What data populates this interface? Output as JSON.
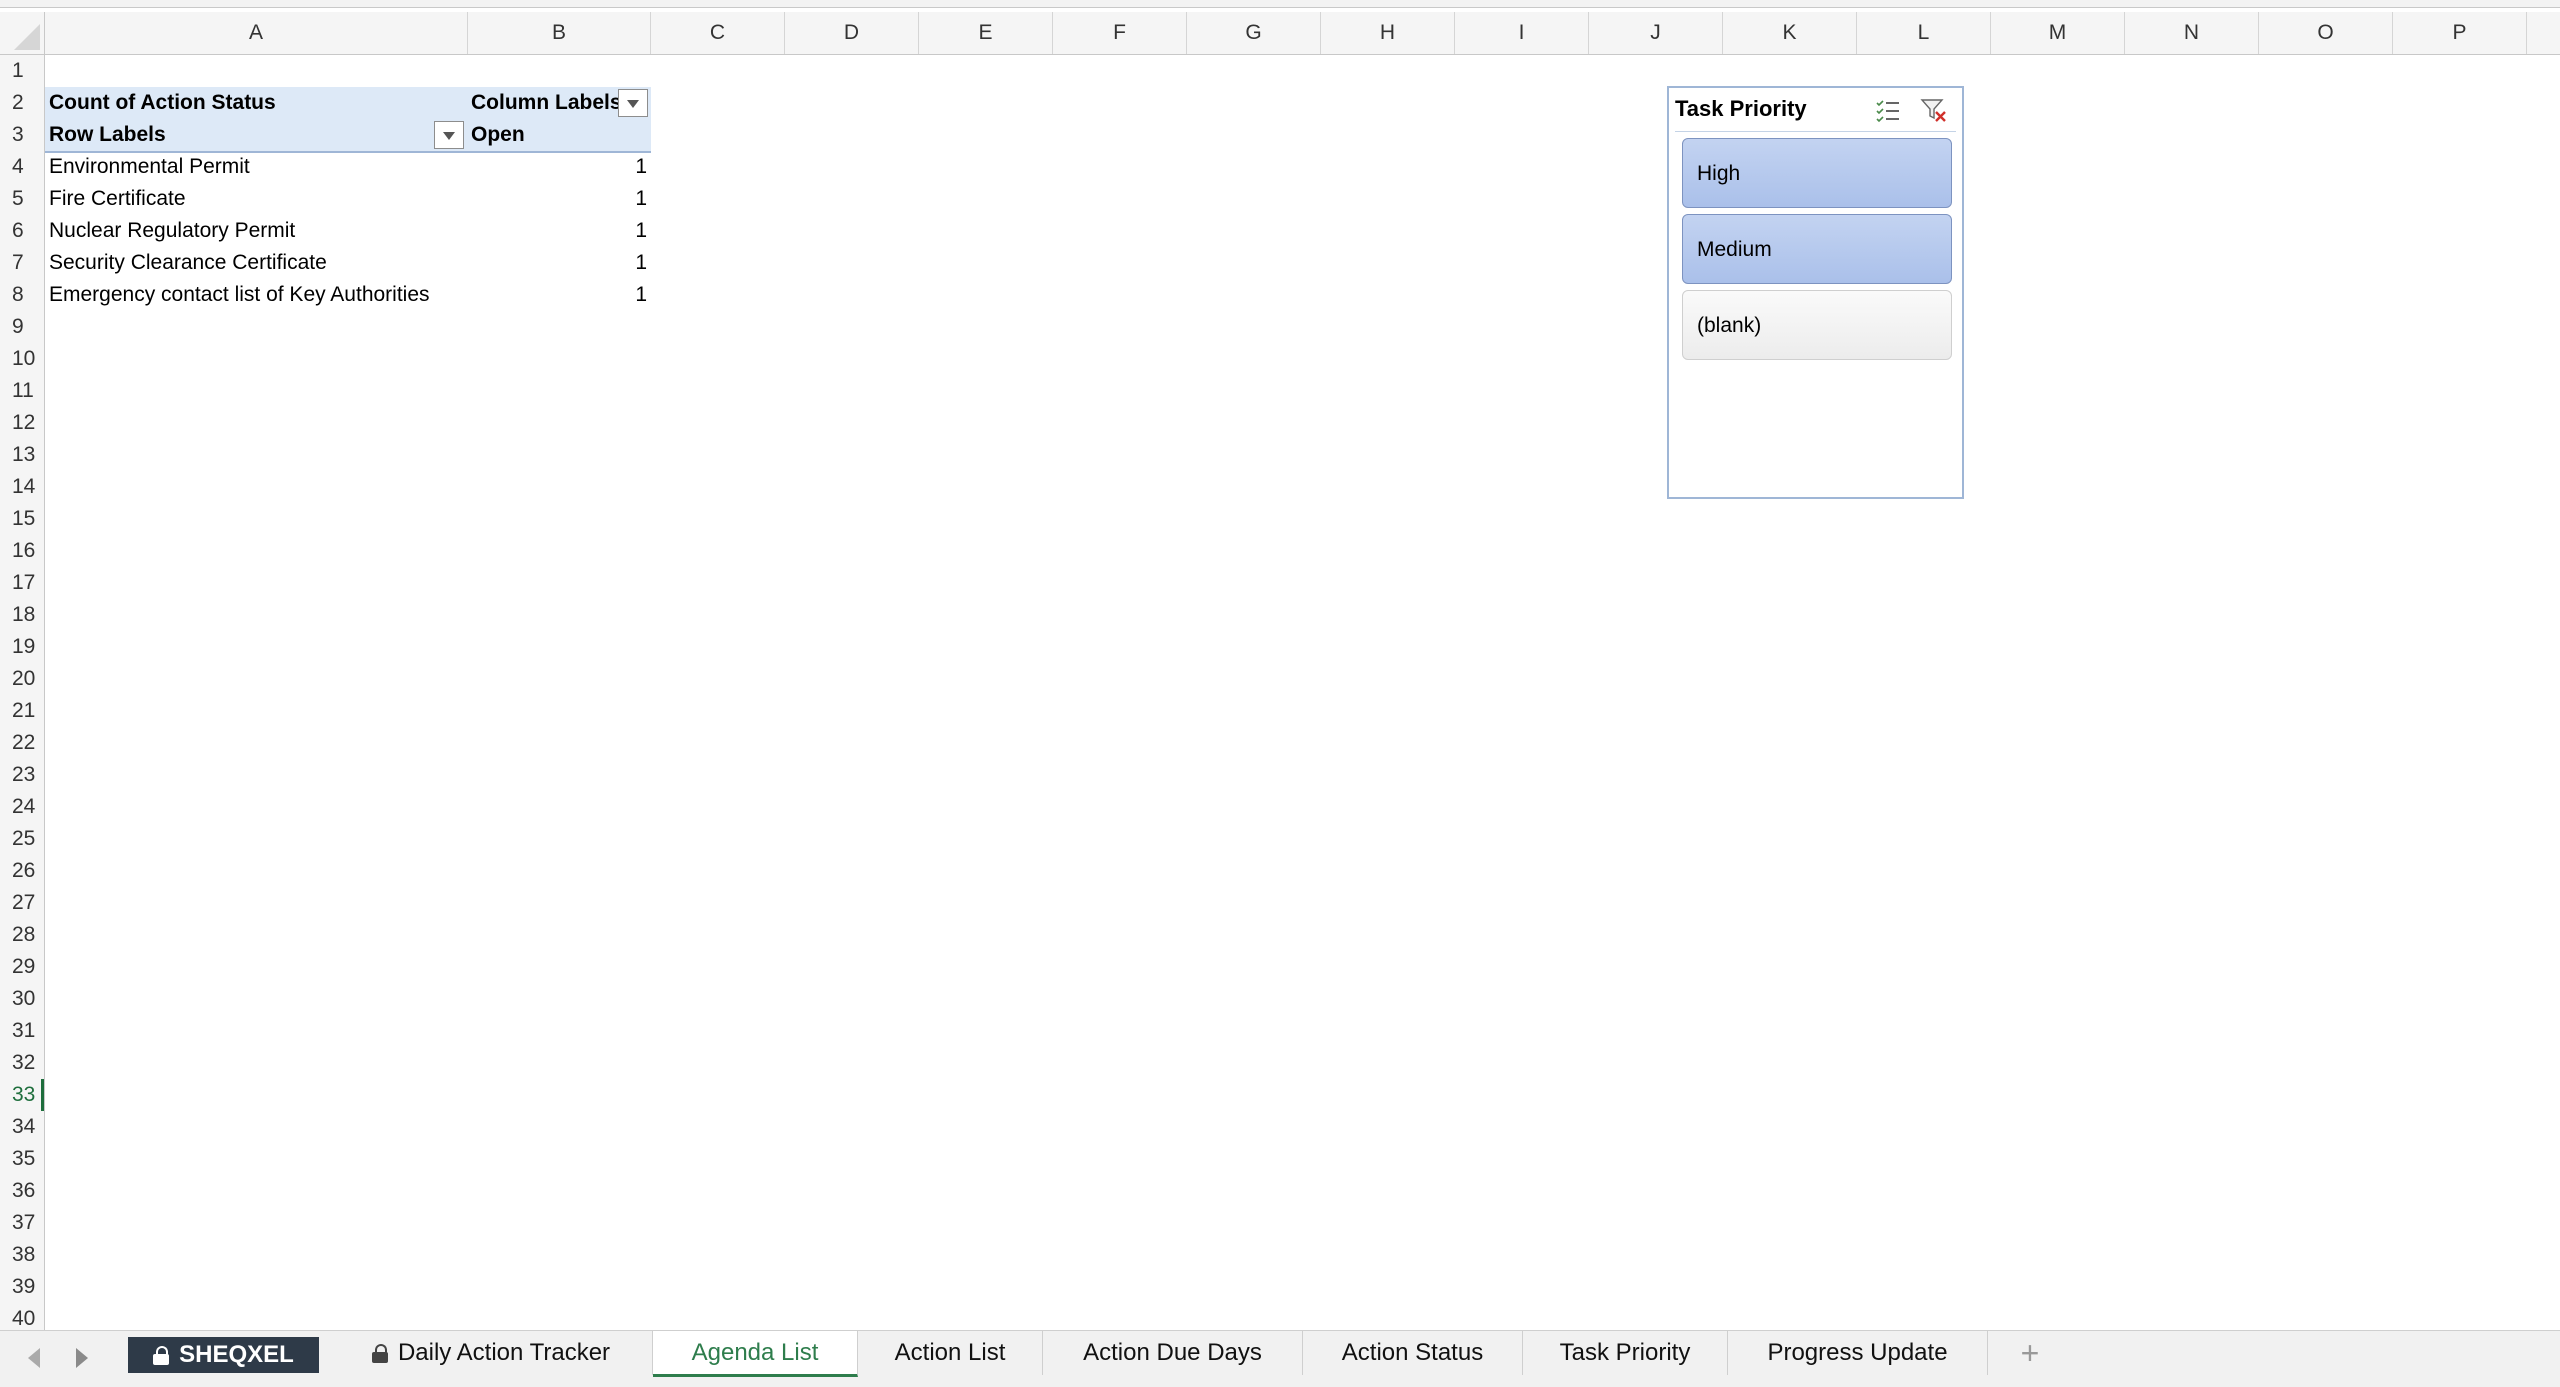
{
  "columns": [
    "A",
    "B",
    "C",
    "D",
    "E",
    "F",
    "G",
    "H",
    "I",
    "J",
    "K",
    "L",
    "M",
    "N",
    "O",
    "P"
  ],
  "rows": [
    "1",
    "2",
    "3",
    "4",
    "5",
    "6",
    "7",
    "8",
    "9",
    "10",
    "11",
    "12",
    "13",
    "14",
    "15",
    "16",
    "17",
    "18",
    "19",
    "20",
    "21",
    "22",
    "23",
    "24",
    "25",
    "26",
    "27",
    "28",
    "29",
    "30",
    "31",
    "32",
    "33",
    "34",
    "35",
    "36",
    "37",
    "38",
    "39",
    "40"
  ],
  "active_row": "33",
  "pivot": {
    "value_field": "Count of Action Status",
    "column_labels": "Column Labels",
    "row_labels": "Row Labels",
    "column_value": "Open",
    "rows": [
      {
        "label": "Environmental Permit",
        "value": "1"
      },
      {
        "label": "Fire Certificate",
        "value": "1"
      },
      {
        "label": "Nuclear Regulatory Permit",
        "value": "1"
      },
      {
        "label": "Security Clearance Certificate",
        "value": "1"
      },
      {
        "label": "Emergency contact list of Key Authorities",
        "value": "1"
      }
    ]
  },
  "slicer": {
    "title": "Task Priority",
    "items": [
      {
        "label": "High",
        "selected": true
      },
      {
        "label": "Medium",
        "selected": true
      },
      {
        "label": "(blank)",
        "selected": false
      }
    ]
  },
  "sheet_tabs": [
    {
      "label": "SHEQXEL",
      "locked": true,
      "style": "dark"
    },
    {
      "label": "Daily Action Tracker",
      "locked": true,
      "style": "normal"
    },
    {
      "label": "Agenda List",
      "locked": false,
      "style": "active"
    },
    {
      "label": "Action List",
      "locked": false,
      "style": "normal"
    },
    {
      "label": "Action Due Days",
      "locked": false,
      "style": "normal"
    },
    {
      "label": "Action Status",
      "locked": false,
      "style": "normal"
    },
    {
      "label": "Task Priority",
      "locked": false,
      "style": "normal"
    },
    {
      "label": "Progress Update",
      "locked": false,
      "style": "normal"
    }
  ],
  "add_sheet_label": "+",
  "colors": {
    "accent_green": "#2e7d4c",
    "pivot_header_bg": "#dde9f7",
    "slicer_selected": "#b4c7ee",
    "tab_dark": "#2e3a48"
  }
}
